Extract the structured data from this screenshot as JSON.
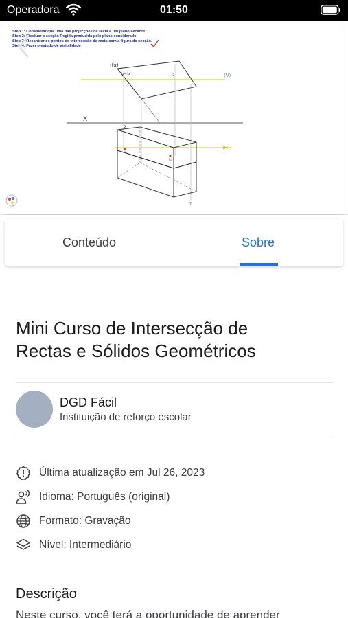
{
  "status_bar": {
    "carrier": "Operadora",
    "time": "01:50"
  },
  "video": {
    "steps": [
      "Step 1: Considerar que uma das projecções da recta é um plano secante.",
      "Step 2: Efectuar a secção Regida produzida pelo plano considerado.",
      "Step 3: Recontrar os pontos de intersecção da recta com a figura da secção.",
      "Step 4: Fazer o estudo de visibilidade"
    ],
    "sketch_labels": {
      "plane": "(fα)",
      "i1": "I₁=I₂",
      "i2": "I₂",
      "v": "(V)",
      "x_axis": "X",
      "h1": "(H)",
      "p1": "I₁",
      "p2": "I₁",
      "p3": "2",
      "p4": "T"
    }
  },
  "tabs": [
    {
      "label": "Conteúdo",
      "active": false
    },
    {
      "label": "Sobre",
      "active": true
    }
  ],
  "course": {
    "title_line1": "Mini Curso de Intersecção de",
    "title_line2": "Rectas e Sólidos Geométricos"
  },
  "author": {
    "name": "DGD Fácil",
    "role": "Instituição de reforço escolar"
  },
  "info": [
    {
      "icon": "alert-clock-icon",
      "text": "Última atualização em Jul 26, 2023"
    },
    {
      "icon": "speaker-icon",
      "text": "Idioma: Português (original)"
    },
    {
      "icon": "globe-icon",
      "text": "Formato: Gravação"
    },
    {
      "icon": "layers-icon",
      "text": "Nível: Intermediário"
    }
  ],
  "description": {
    "title": "Descrição",
    "text": "Neste curso, você terá a oportunidade de aprender"
  },
  "colors": {
    "accent": "#1a73e8",
    "avatar": "#a4b0c2"
  }
}
